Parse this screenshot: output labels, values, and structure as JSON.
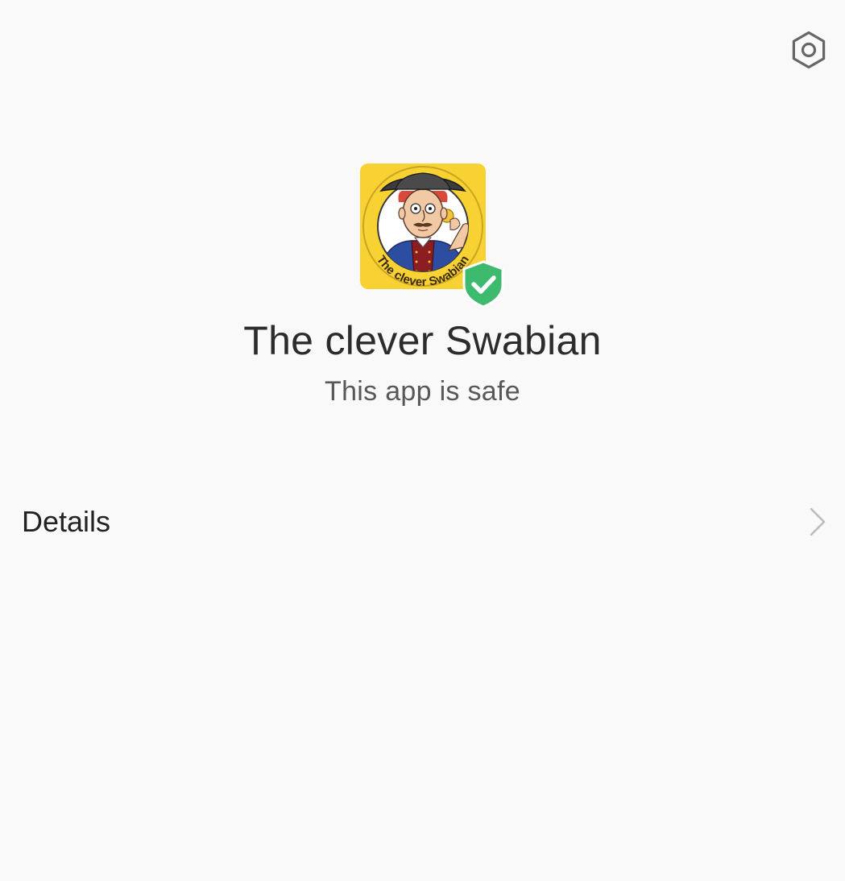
{
  "header": {
    "settings_icon": "gear-icon"
  },
  "app": {
    "name": "The clever Swabian",
    "status": "This app is safe",
    "icon_badge": "shield-check-icon",
    "icon_ring_text": "The clever Swabian"
  },
  "details": {
    "label": "Details",
    "chevron_icon": "chevron-right-icon"
  },
  "colors": {
    "background": "#f9f9f9",
    "shield_green": "#3dba6e",
    "icon_yellow": "#f7d232",
    "coat_blue": "#2c4da0"
  }
}
